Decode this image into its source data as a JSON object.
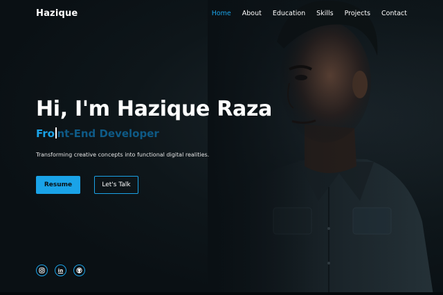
{
  "brand": "Hazique",
  "nav": {
    "items": [
      {
        "label": "Home",
        "active": true
      },
      {
        "label": "About",
        "active": false
      },
      {
        "label": "Education",
        "active": false
      },
      {
        "label": "Skills",
        "active": false
      },
      {
        "label": "Projects",
        "active": false
      },
      {
        "label": "Contact",
        "active": false
      }
    ]
  },
  "hero": {
    "title": "Hi, I'm Hazique Raza",
    "role_typed": "Fro",
    "role_rest": "nt-End Developer",
    "description": "Transforming creative concepts into functional digital realities.",
    "resume_label": "Resume",
    "talk_label": "Let's Talk"
  },
  "socials": [
    {
      "icon": "instagram-icon"
    },
    {
      "icon": "linkedin-icon",
      "text": "in"
    },
    {
      "icon": "github-icon"
    }
  ],
  "colors": {
    "accent": "#1aa3e8",
    "background": "#0a1014",
    "text": "#ffffff"
  }
}
